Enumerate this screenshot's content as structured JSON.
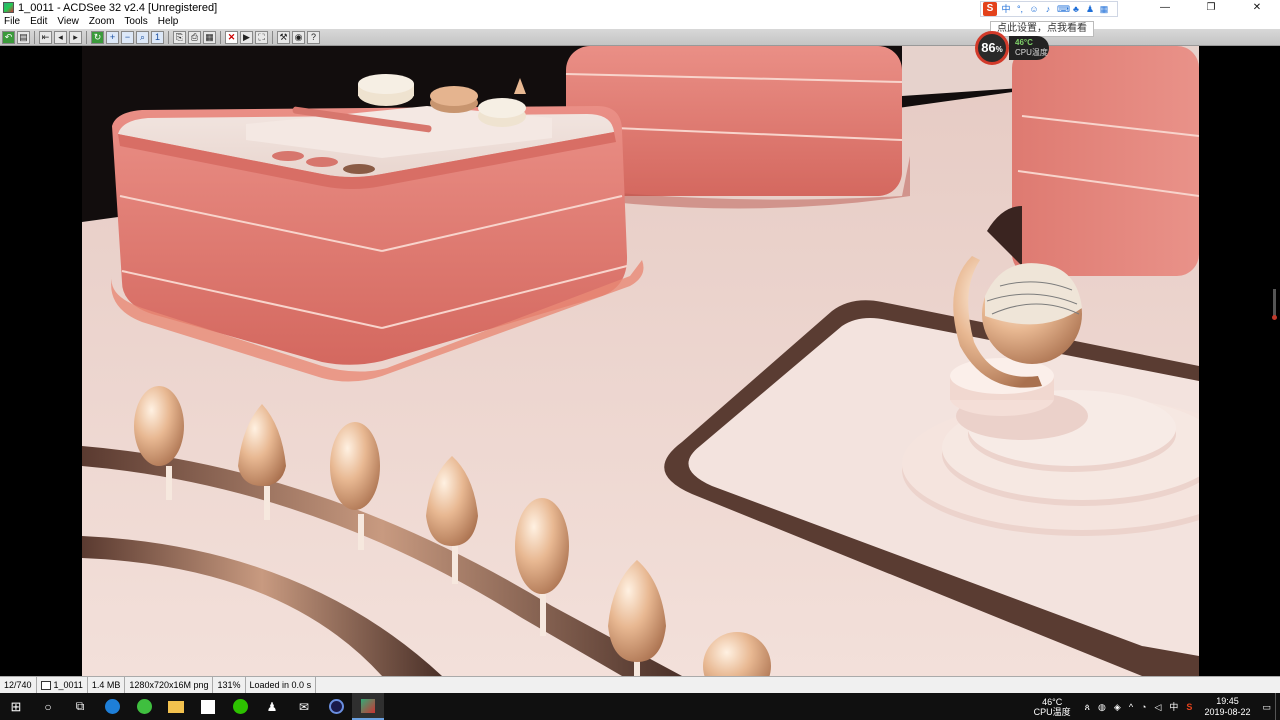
{
  "window": {
    "title": "1_0011 - ACDSee 32 v2.4 [Unregistered]",
    "controls": {
      "minimize": "—",
      "maximize": "❐",
      "close": "✕"
    }
  },
  "menu": [
    "File",
    "Edit",
    "View",
    "Zoom",
    "Tools",
    "Help"
  ],
  "ime": {
    "logo": "S",
    "lang": "中",
    "tooltip": "点此设置，点我看看"
  },
  "cpu_widget": {
    "load_value": "86",
    "load_unit": "%",
    "temp": "46°C",
    "label": "CPU温度"
  },
  "status": {
    "position": "12/740",
    "filename": "1_0011",
    "size": "1.4 MB",
    "dimensions": "1280x720x16M png",
    "zoom": "131%",
    "load_time": "Loaded in 0.0 s"
  },
  "taskbar": {
    "cpu_temp": "46°C",
    "cpu_label": "CPU温度",
    "ime_lang": "中",
    "time": "19:45",
    "date": "2019-08-22"
  },
  "colors": {
    "coral": "#e07b72",
    "floor": "#efd6d0",
    "gold": "#d9a57f"
  }
}
